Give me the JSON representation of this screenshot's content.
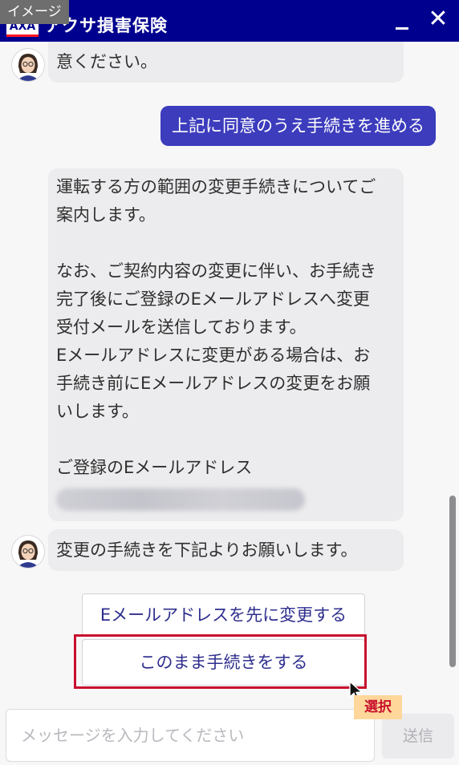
{
  "image_tag": "イメージ",
  "header": {
    "logo_text": "AXA",
    "title": "アクサ損害保険",
    "minimize_icon": "minimize-icon",
    "close_icon": "close-icon",
    "close_glyph": "✕",
    "background": "#00008f"
  },
  "chat": {
    "bot_message_1": {
      "lines": [
        "意ください。"
      ]
    },
    "user_message": "上記に同意のうえ手続きを進める",
    "bot_message_2": {
      "lines": [
        "運転する方の範囲の変更手続きについてご",
        "案内します。",
        "",
        "なお、ご契約内容の変更に伴い、お手続き",
        "完了後にご登録のEメールアドレスへ変更",
        "受付メールを送信しております。",
        "Eメールアドレスに変更がある場合は、お",
        "手続き前にEメールアドレスの変更をお願",
        "いします。",
        "",
        "ご登録のEメールアドレス"
      ]
    },
    "bot_message_3": "変更の手続きを下記よりお願いします。",
    "options": [
      "Eメールアドレスを先に変更する",
      "このまま手続きをする"
    ],
    "annotation_label": "選択",
    "user_bubble_color": "#3c3cbd",
    "highlight_color": "#c8102e"
  },
  "footer": {
    "input_placeholder": "メッセージを入力してください",
    "send_label": "送信"
  }
}
